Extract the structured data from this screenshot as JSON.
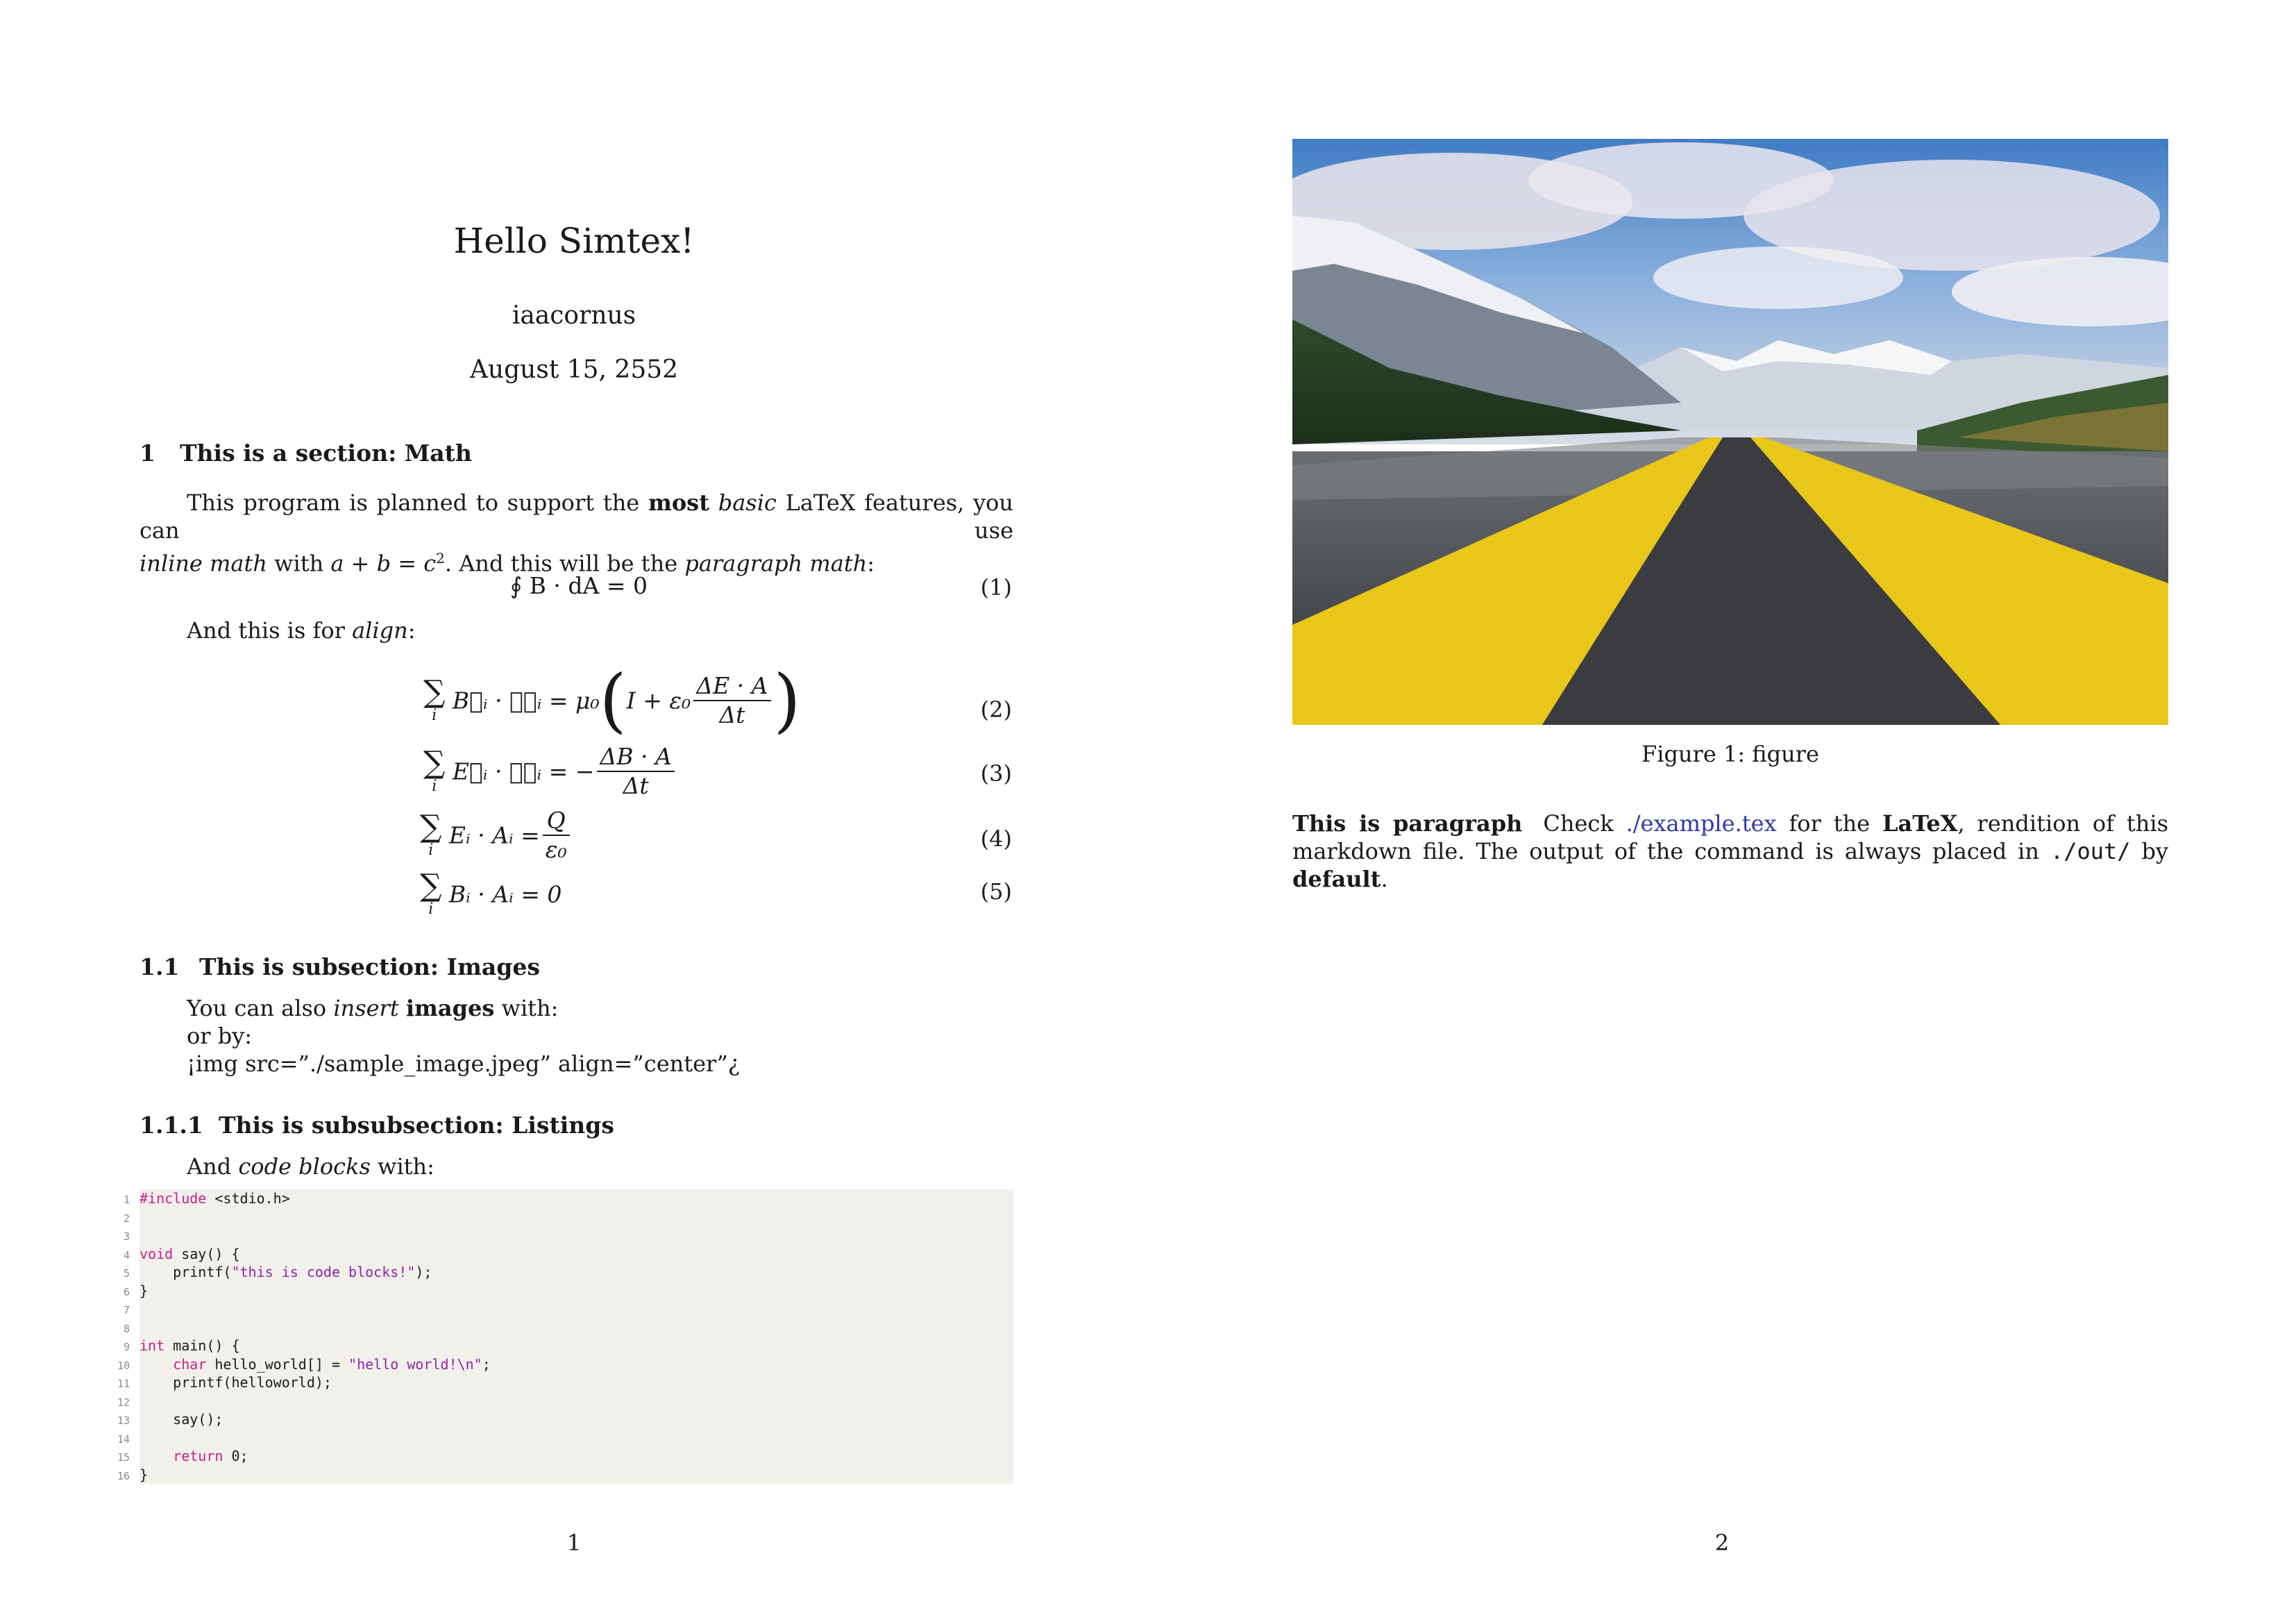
{
  "page1": {
    "title": "Hello Simtex!",
    "author": "iaacornus",
    "date": "August 15, 2552",
    "section1": {
      "number": "1",
      "title": "This is a section: Math"
    },
    "para1": {
      "t1": "This program is planned to support the ",
      "bold": "most",
      "t2": " ",
      "italic": "basic",
      "t3": " LaTeX features, you can use",
      "italic2": "inline math",
      "t4": " with ",
      "math": "a + b = c",
      "sup": "2",
      "t5": ". And this will be the ",
      "italic3": "paragraph math",
      "t6": ":"
    },
    "eq1": {
      "number": "(1)",
      "content": "∮ B · dA = 0"
    },
    "align_intro": {
      "t1": "And this is for ",
      "italic": "align",
      "t2": ":"
    },
    "eq2": {
      "number": "(2)",
      "lhs": "B⃗ᵢ · ℓ⃗ᵢ = μ₀",
      "inner": "I + ε₀",
      "num": "ΔE · A",
      "den": "Δt"
    },
    "eq3": {
      "number": "(3)",
      "lhs": "E⃗ᵢ · ℓ⃗ᵢ = −",
      "num": "ΔB · A",
      "den": "Δt"
    },
    "eq4": {
      "number": "(4)",
      "lhs": "Eᵢ · Aᵢ =",
      "num": "Q",
      "den": "ε₀"
    },
    "eq5": {
      "number": "(5)",
      "lhs": "Bᵢ · Aᵢ = 0"
    },
    "sum_index": "i",
    "subsection": {
      "number": "1.1",
      "title": "This is subsection: Images"
    },
    "images_para": {
      "t1": "You can also ",
      "italic": "insert",
      "t2": " ",
      "bold": "images",
      "t3": " with:",
      "line2": "or by:",
      "line3": "¡img src=”./sample_image.jpeg” align=”center”¿"
    },
    "subsubsection": {
      "number": "1.1.1",
      "title": "This is subsubsection: Listings"
    },
    "code_intro": {
      "t1": "And ",
      "italic": "code blocks",
      "t2": " with:"
    },
    "code": [
      {
        "n": "1",
        "parts": [
          {
            "c": "kw",
            "t": "#include"
          },
          {
            "c": "",
            "t": " <stdio.h>"
          }
        ]
      },
      {
        "n": "2",
        "parts": []
      },
      {
        "n": "3",
        "parts": []
      },
      {
        "n": "4",
        "parts": [
          {
            "c": "kw",
            "t": "void"
          },
          {
            "c": "",
            "t": " say() {"
          }
        ]
      },
      {
        "n": "5",
        "parts": [
          {
            "c": "",
            "t": "    printf("
          },
          {
            "c": "str",
            "t": "\"this is code blocks!\""
          },
          {
            "c": "",
            "t": ");"
          }
        ]
      },
      {
        "n": "6",
        "parts": [
          {
            "c": "",
            "t": "}"
          }
        ]
      },
      {
        "n": "7",
        "parts": []
      },
      {
        "n": "8",
        "parts": []
      },
      {
        "n": "9",
        "parts": [
          {
            "c": "kw",
            "t": "int"
          },
          {
            "c": "",
            "t": " main() {"
          }
        ]
      },
      {
        "n": "10",
        "parts": [
          {
            "c": "",
            "t": "    "
          },
          {
            "c": "kw",
            "t": "char"
          },
          {
            "c": "",
            "t": " hello_world[] = "
          },
          {
            "c": "str",
            "t": "\"hello world!\\n\""
          },
          {
            "c": "",
            "t": ";"
          }
        ]
      },
      {
        "n": "11",
        "parts": [
          {
            "c": "",
            "t": "    printf(helloworld);"
          }
        ]
      },
      {
        "n": "12",
        "parts": []
      },
      {
        "n": "13",
        "parts": [
          {
            "c": "",
            "t": "    say();"
          }
        ]
      },
      {
        "n": "14",
        "parts": []
      },
      {
        "n": "15",
        "parts": [
          {
            "c": "",
            "t": "    "
          },
          {
            "c": "kw",
            "t": "return"
          },
          {
            "c": "",
            "t": " 0;"
          }
        ]
      },
      {
        "n": "16",
        "parts": [
          {
            "c": "",
            "t": "}"
          }
        ]
      }
    ],
    "page_number": "1"
  },
  "page2": {
    "figure_caption": "Figure 1: figure",
    "paragraph": {
      "run_in": "This is paragraph",
      "t1": "Check ",
      "link": "./example.tex",
      "t2": " for the ",
      "bold1": "LaTeX",
      "t3": ", rendition of this markdown file. The output of the command is always placed in ",
      "code": "./out/",
      "t4": " by ",
      "bold2": "default",
      "t5": "."
    },
    "page_number": "2"
  },
  "colors": {
    "code_bg": "#f2f0ea",
    "keyword": "#c7218a",
    "string": "#8e24aa",
    "link": "#2b3aa8",
    "road_line": "#e8c61a"
  },
  "icons": [
    "road-photo"
  ]
}
